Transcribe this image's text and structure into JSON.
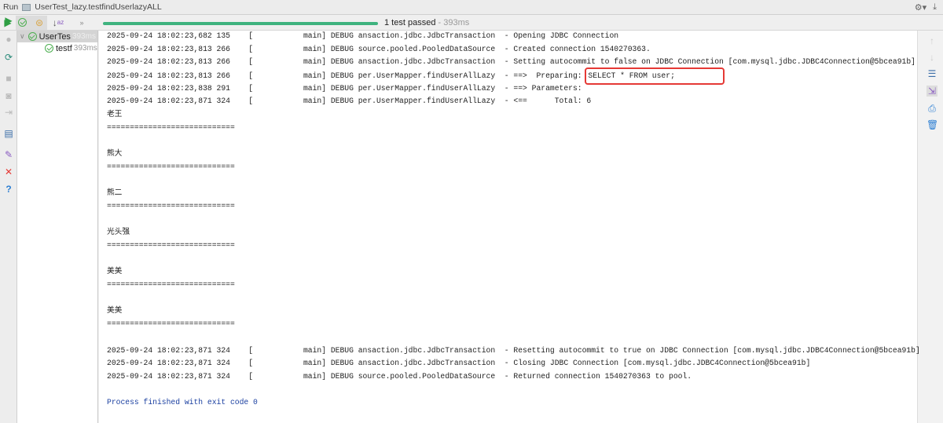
{
  "window": {
    "run_label": "Run",
    "config_name": "UserTest_lazy.testfindUserlazyALL"
  },
  "toolbar": {
    "status_count": "1 test passed",
    "status_time": "- 393ms",
    "more": "»",
    "progress_percent": 100
  },
  "tree": {
    "items": [
      {
        "label": "UserTes",
        "time": "393ms"
      },
      {
        "label": "testf",
        "time": "393ms"
      }
    ]
  },
  "console": {
    "lines": [
      "2025-09-24 18:02:23,682 135    [           main] DEBUG ansaction.jdbc.JdbcTransaction  - Opening JDBC Connection",
      "2025-09-24 18:02:23,813 266    [           main] DEBUG source.pooled.PooledDataSource  - Created connection 1540270363.",
      "2025-09-24 18:02:23,813 266    [           main] DEBUG ansaction.jdbc.JdbcTransaction  - Setting autocommit to false on JDBC Connection [com.mysql.jdbc.JDBC4Connection@5bcea91b]",
      {
        "prefix": "2025-09-24 18:02:23,813 266    [           main] DEBUG per.UserMapper.findUserAllLazy  - ==>  Preparing: ",
        "highlight": "SELECT * FROM user;"
      },
      "2025-09-24 18:02:23,838 291    [           main] DEBUG per.UserMapper.findUserAllLazy  - ==> Parameters: ",
      "2025-09-24 18:02:23,871 324    [           main] DEBUG per.UserMapper.findUserAllLazy  - <==      Total: 6",
      "老王",
      "============================",
      "",
      "熊大",
      "============================",
      "",
      "熊二",
      "============================",
      "",
      "光头强",
      "============================",
      "",
      "美美",
      "============================",
      "",
      "美美",
      "============================",
      "",
      "2025-09-24 18:02:23,871 324    [           main] DEBUG ansaction.jdbc.JdbcTransaction  - Resetting autocommit to true on JDBC Connection [com.mysql.jdbc.JDBC4Connection@5bcea91b]",
      "2025-09-24 18:02:23,871 324    [           main] DEBUG ansaction.jdbc.JdbcTransaction  - Closing JDBC Connection [com.mysql.jdbc.JDBC4Connection@5bcea91b]",
      "2025-09-24 18:02:23,871 324    [           main] DEBUG source.pooled.PooledDataSource  - Returned connection 1540270363 to pool.",
      ""
    ],
    "exit_message": "Process finished with exit code 0"
  },
  "colors": {
    "progress": "#3fb37f",
    "highlight_border": "#e53935",
    "exit_text": "#1a3fa0"
  }
}
